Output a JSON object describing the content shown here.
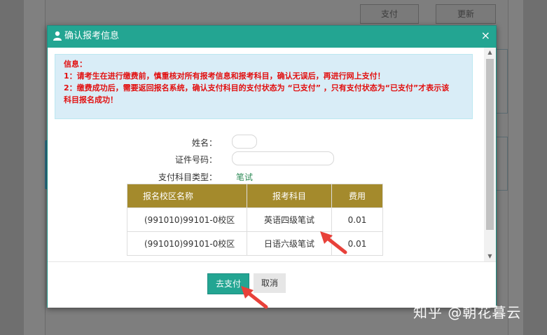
{
  "background": {
    "buttons": {
      "pay": "支付",
      "refresh": "更新"
    }
  },
  "modal": {
    "title": "确认报考信息",
    "close": "×",
    "notice": {
      "heading": "信息：",
      "line1": "1：请考生在进行缴费前，慎重核对所有报考信息和报考科目，确认无误后，再进行网上支付！",
      "line2": "2：缴费成功后，需要返回报名系统，确认支付科目的支付状态为 “已支付” ，只有支付状态为“已支付”才表示该科目报名成功！"
    },
    "form": {
      "name_label": "姓名：",
      "id_label": "证件号码：",
      "subject_type_label": "支付科目类型：",
      "subject_type_value": "笔试"
    },
    "table": {
      "headers": [
        "报名校区名称",
        "报考科目",
        "费用"
      ],
      "rows": [
        [
          "(991010)99101-0校区",
          "英语四级笔试",
          "0.01"
        ],
        [
          "(991010)99101-0校区",
          "日语六级笔试",
          "0.01"
        ]
      ]
    },
    "footer": {
      "pay_button": "去支付",
      "cancel_button": "取消"
    }
  },
  "watermark": "知乎 @朝花暮云",
  "colors": {
    "accent": "#23a592",
    "table_header": "#a48a2c",
    "notice_text": "#e20f0f",
    "notice_bg": "#d9edf7",
    "annotation_arrow": "#e8413a"
  }
}
